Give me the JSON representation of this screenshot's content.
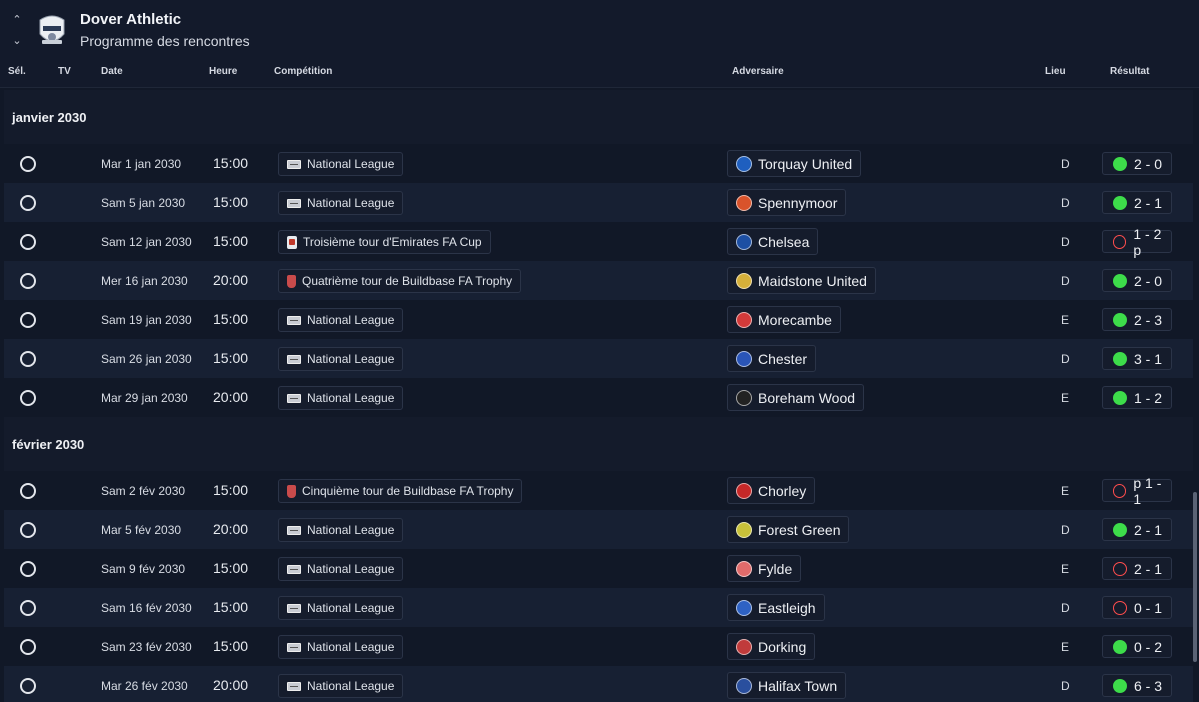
{
  "header": {
    "club_name": "Dover Athletic",
    "subtitle": "Programme des rencontres",
    "up_icon": "chevron-up-icon",
    "down_icon": "chevron-down-icon"
  },
  "columns": {
    "sel": "Sél.",
    "tv": "TV",
    "date": "Date",
    "time": "Heure",
    "competition": "Compétition",
    "opponent": "Adversaire",
    "venue": "Lieu",
    "result": "Résultat"
  },
  "colors": {
    "win": "#3ddc4a",
    "loss": "#ff4d4d",
    "background": "#111827"
  },
  "months": [
    {
      "label": "janvier 2030",
      "matches": [
        {
          "date": "Mar 1 jan 2030",
          "time": "15:00",
          "competition": "National League",
          "comp_icon": "league",
          "opponent": "Torquay United",
          "badge": "#1f5fbf",
          "venue": "D",
          "result": "2 - 0",
          "outcome": "win"
        },
        {
          "date": "Sam 5 jan 2030",
          "time": "15:00",
          "competition": "National League",
          "comp_icon": "league",
          "opponent": "Spennymoor",
          "badge": "#d9532b",
          "venue": "D",
          "result": "2 - 1",
          "outcome": "win"
        },
        {
          "date": "Sam 12 jan 2030",
          "time": "15:00",
          "competition": "Troisième tour d'Emirates FA Cup",
          "comp_icon": "cup",
          "opponent": "Chelsea",
          "badge": "#1d4fa3",
          "venue": "D",
          "result": "1 - 2 p",
          "outcome": "loss"
        },
        {
          "date": "Mer 16 jan 2030",
          "time": "20:00",
          "competition": "Quatrième tour de Buildbase FA Trophy",
          "comp_icon": "trophy",
          "opponent": "Maidstone United",
          "badge": "#d6b03a",
          "venue": "D",
          "result": "2 - 0",
          "outcome": "win"
        },
        {
          "date": "Sam 19 jan 2030",
          "time": "15:00",
          "competition": "National League",
          "comp_icon": "league",
          "opponent": "Morecambe",
          "badge": "#d23a3a",
          "venue": "E",
          "result": "2 - 3",
          "outcome": "win"
        },
        {
          "date": "Sam 26 jan 2030",
          "time": "15:00",
          "competition": "National League",
          "comp_icon": "league",
          "opponent": "Chester",
          "badge": "#2a55b8",
          "venue": "D",
          "result": "3 - 1",
          "outcome": "win"
        },
        {
          "date": "Mar 29 jan 2030",
          "time": "20:00",
          "competition": "National League",
          "comp_icon": "league",
          "opponent": "Boreham Wood",
          "badge": "#222222",
          "venue": "E",
          "result": "1 - 2",
          "outcome": "win"
        }
      ]
    },
    {
      "label": "février 2030",
      "matches": [
        {
          "date": "Sam 2 fév 2030",
          "time": "15:00",
          "competition": "Cinquième tour de Buildbase FA Trophy",
          "comp_icon": "trophy",
          "opponent": "Chorley",
          "badge": "#c62828",
          "venue": "E",
          "result": "p 1 - 1",
          "outcome": "loss"
        },
        {
          "date": "Mar 5 fév 2030",
          "time": "20:00",
          "competition": "National League",
          "comp_icon": "league",
          "opponent": "Forest Green",
          "badge": "#c9c23a",
          "venue": "D",
          "result": "2 - 1",
          "outcome": "win"
        },
        {
          "date": "Sam 9 fév 2030",
          "time": "15:00",
          "competition": "National League",
          "comp_icon": "league",
          "opponent": "Fylde",
          "badge": "#e06b6b",
          "venue": "E",
          "result": "2 - 1",
          "outcome": "loss"
        },
        {
          "date": "Sam 16 fév 2030",
          "time": "15:00",
          "competition": "National League",
          "comp_icon": "league",
          "opponent": "Eastleigh",
          "badge": "#2e62c4",
          "venue": "D",
          "result": "0 - 1",
          "outcome": "loss"
        },
        {
          "date": "Sam 23 fév 2030",
          "time": "15:00",
          "competition": "National League",
          "comp_icon": "league",
          "opponent": "Dorking",
          "badge": "#c03b3b",
          "venue": "E",
          "result": "0 - 2",
          "outcome": "win"
        },
        {
          "date": "Mar 26 fév 2030",
          "time": "20:00",
          "competition": "National League",
          "comp_icon": "league",
          "opponent": "Halifax Town",
          "badge": "#2a4f9e",
          "venue": "D",
          "result": "6 - 3",
          "outcome": "win"
        }
      ]
    }
  ]
}
